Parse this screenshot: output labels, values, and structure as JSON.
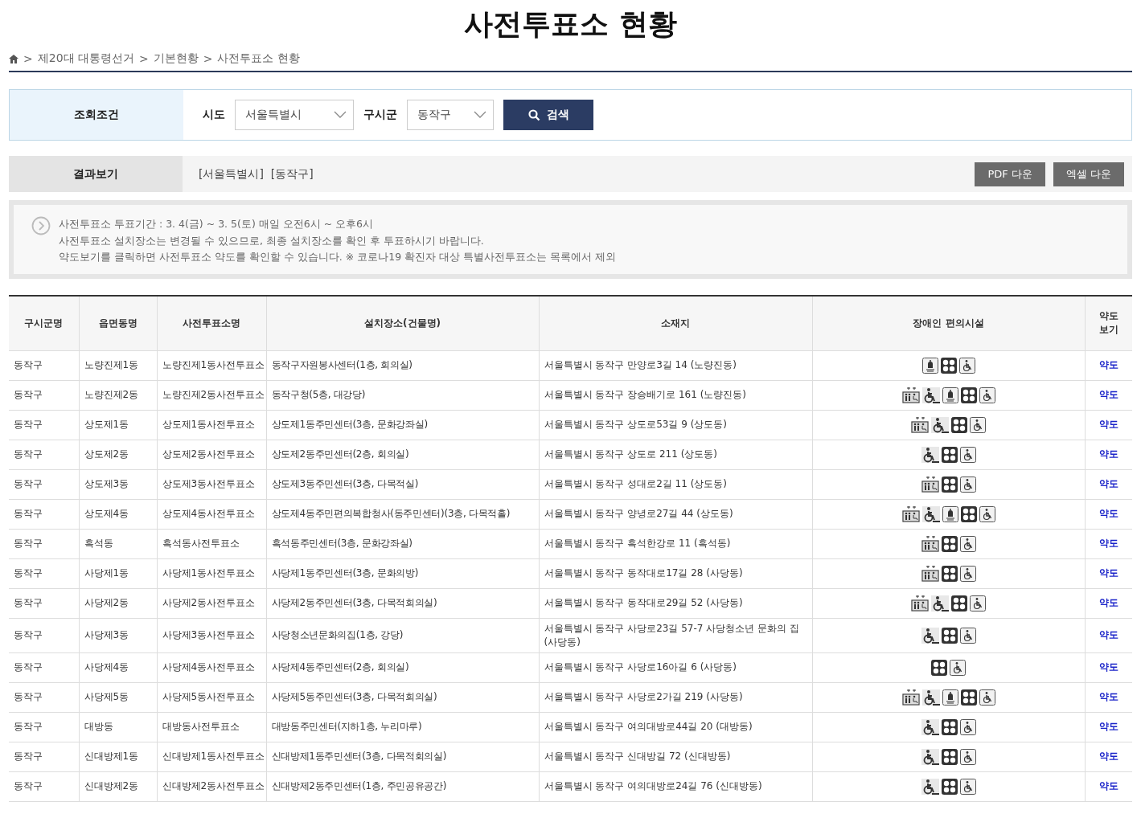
{
  "title": "사전투표소 현황",
  "breadcrumb": {
    "separator": ">",
    "items": [
      "제20대 대통령선거",
      "기본현황",
      "사전투표소 현황"
    ]
  },
  "search": {
    "label": "조회조건",
    "fields": [
      {
        "label": "시도",
        "value": "서울특별시"
      },
      {
        "label": "구시군",
        "value": "동작구"
      }
    ],
    "button": "검색"
  },
  "result": {
    "label": "결과보기",
    "text": "[서울특별시]  [동작구]",
    "buttons": [
      "PDF 다운",
      "엑셀 다운"
    ]
  },
  "notice": [
    "사전투표소 투표기간 : 3. 4(금) ~ 3. 5(토) 매일 오전6시 ~ 오후6시",
    "사전투표소 설치장소는 변경될 수 있으므로, 최종 설치장소를 확인 후 투표하시기 바랍니다.",
    "약도보기를 클릭하면 사전투표소 약도를 확인할 수 있습니다. ※ 코로나19 확진자 대상 특별사전투표소는 목록에서 제외"
  ],
  "table": {
    "columns": [
      "구시군명",
      "읍면동명",
      "사전투표소명",
      "설치장소(건물명)",
      "소재지",
      "장애인 편의시설",
      "약도\n보기"
    ],
    "rows": [
      {
        "gu": "동작구",
        "dong": "노량진제1동",
        "name": "노량진제1동사전투표소",
        "place": "동작구자원봉사센터(1층, 회의실)",
        "address": "서울특별시 동작구 만양로3길 14 (노량진동)",
        "facilities": [
          {
            "kind": "bell"
          },
          {
            "kind": "dots"
          },
          {
            "kind": "toilet"
          }
        ],
        "map": "약도"
      },
      {
        "gu": "동작구",
        "dong": "노량진제2동",
        "name": "노량진제2동사전투표소",
        "place": "동작구청(5층, 대강당)",
        "address": "서울특별시 동작구 장승배기로 161 (노량진동)",
        "facilities": [
          {
            "kind": "elevator"
          },
          {
            "kind": "ramp"
          },
          {
            "kind": "bell"
          },
          {
            "kind": "dots"
          },
          {
            "kind": "toilet"
          }
        ],
        "map": "약도"
      },
      {
        "gu": "동작구",
        "dong": "상도제1동",
        "name": "상도제1동사전투표소",
        "place": "상도제1동주민센터(3층, 문화강좌실)",
        "address": "서울특별시 동작구 상도로53길 9 (상도동)",
        "facilities": [
          {
            "kind": "elevator"
          },
          {
            "kind": "ramp"
          },
          {
            "kind": "dots"
          },
          {
            "kind": "toilet"
          }
        ],
        "map": "약도"
      },
      {
        "gu": "동작구",
        "dong": "상도제2동",
        "name": "상도제2동사전투표소",
        "place": "상도제2동주민센터(2층, 회의실)",
        "address": "서울특별시 동작구 상도로 211 (상도동)",
        "facilities": [
          {
            "kind": "ramp"
          },
          {
            "kind": "dots"
          },
          {
            "kind": "toilet"
          }
        ],
        "map": "약도"
      },
      {
        "gu": "동작구",
        "dong": "상도제3동",
        "name": "상도제3동사전투표소",
        "place": "상도제3동주민센터(3층, 다목적실)",
        "address": "서울특별시 동작구 성대로2길 11 (상도동)",
        "facilities": [
          {
            "kind": "elevator"
          },
          {
            "kind": "dots"
          },
          {
            "kind": "toilet"
          }
        ],
        "map": "약도"
      },
      {
        "gu": "동작구",
        "dong": "상도제4동",
        "name": "상도제4동사전투표소",
        "place": "상도제4동주민편의복합청사(동주민센터)(3층, 다목적홀)",
        "address": "서울특별시 동작구 양녕로27길 44 (상도동)",
        "facilities": [
          {
            "kind": "elevator"
          },
          {
            "kind": "ramp"
          },
          {
            "kind": "bell"
          },
          {
            "kind": "dots"
          },
          {
            "kind": "toilet"
          }
        ],
        "map": "약도"
      },
      {
        "gu": "동작구",
        "dong": "흑석동",
        "name": "흑석동사전투표소",
        "place": "흑석동주민센터(3층, 문화강좌실)",
        "address": "서울특별시 동작구 흑석한강로 11 (흑석동)",
        "facilities": [
          {
            "kind": "elevator"
          },
          {
            "kind": "dots"
          },
          {
            "kind": "toilet"
          }
        ],
        "map": "약도"
      },
      {
        "gu": "동작구",
        "dong": "사당제1동",
        "name": "사당제1동사전투표소",
        "place": "사당제1동주민센터(3층, 문화의방)",
        "address": "서울특별시 동작구 동작대로17길 28 (사당동)",
        "facilities": [
          {
            "kind": "elevator"
          },
          {
            "kind": "dots"
          },
          {
            "kind": "toilet"
          }
        ],
        "map": "약도"
      },
      {
        "gu": "동작구",
        "dong": "사당제2동",
        "name": "사당제2동사전투표소",
        "place": "사당제2동주민센터(3층, 다목적회의실)",
        "address": "서울특별시 동작구 동작대로29길 52 (사당동)",
        "facilities": [
          {
            "kind": "elevator"
          },
          {
            "kind": "ramp"
          },
          {
            "kind": "dots"
          },
          {
            "kind": "toilet"
          }
        ],
        "map": "약도"
      },
      {
        "gu": "동작구",
        "dong": "사당제3동",
        "name": "사당제3동사전투표소",
        "place": "사당청소년문화의집(1층, 강당)",
        "address": "서울특별시 동작구 사당로23길 57-7 사당청소년 문화의 집 (사당동)",
        "facilities": [
          {
            "kind": "ramp"
          },
          {
            "kind": "dots"
          },
          {
            "kind": "toilet"
          }
        ],
        "map": "약도"
      },
      {
        "gu": "동작구",
        "dong": "사당제4동",
        "name": "사당제4동사전투표소",
        "place": "사당제4동주민센터(2층, 회의실)",
        "address": "서울특별시 동작구 사당로16아길 6 (사당동)",
        "facilities": [
          {
            "kind": "dots"
          },
          {
            "kind": "toilet"
          }
        ],
        "map": "약도"
      },
      {
        "gu": "동작구",
        "dong": "사당제5동",
        "name": "사당제5동사전투표소",
        "place": "사당제5동주민센터(3층, 다목적회의실)",
        "address": "서울특별시 동작구 사당로2가길 219 (사당동)",
        "facilities": [
          {
            "kind": "elevator"
          },
          {
            "kind": "ramp"
          },
          {
            "kind": "bell"
          },
          {
            "kind": "dots"
          },
          {
            "kind": "toilet"
          }
        ],
        "map": "약도"
      },
      {
        "gu": "동작구",
        "dong": "대방동",
        "name": "대방동사전투표소",
        "place": "대방동주민센터(지하1층, 누리마루)",
        "address": "서울특별시 동작구 여의대방로44길 20 (대방동)",
        "facilities": [
          {
            "kind": "ramp"
          },
          {
            "kind": "dots"
          },
          {
            "kind": "toilet"
          }
        ],
        "map": "약도"
      },
      {
        "gu": "동작구",
        "dong": "신대방제1동",
        "name": "신대방제1동사전투표소",
        "place": "신대방제1동주민센터(3층, 다목적회의실)",
        "address": "서울특별시 동작구 신대방길 72 (신대방동)",
        "facilities": [
          {
            "kind": "ramp"
          },
          {
            "kind": "dots"
          },
          {
            "kind": "toilet"
          }
        ],
        "map": "약도"
      },
      {
        "gu": "동작구",
        "dong": "신대방제2동",
        "name": "신대방제2동사전투표소",
        "place": "신대방제2동주민센터(1층, 주민공유공간)",
        "address": "서울특별시 동작구 여의대방로24길 76 (신대방동)",
        "facilities": [
          {
            "kind": "ramp"
          },
          {
            "kind": "dots"
          },
          {
            "kind": "toilet"
          }
        ],
        "map": "약도"
      }
    ]
  }
}
